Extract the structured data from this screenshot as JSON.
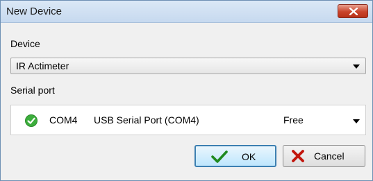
{
  "window": {
    "title": "New Device",
    "close_icon": "close-icon"
  },
  "device": {
    "label": "Device",
    "selected": "IR Actimeter"
  },
  "serial_port": {
    "label": "Serial port",
    "status_icon": "check-circle-icon",
    "status_color": "#3cae3c",
    "port_name": "COM4",
    "description": "USB Serial Port (COM4)",
    "state": "Free"
  },
  "buttons": {
    "ok_label": "OK",
    "ok_icon": "checkmark-icon",
    "ok_icon_color": "#1f8a1f",
    "cancel_label": "Cancel",
    "cancel_icon": "x-icon",
    "cancel_icon_color": "#c2160d"
  }
}
